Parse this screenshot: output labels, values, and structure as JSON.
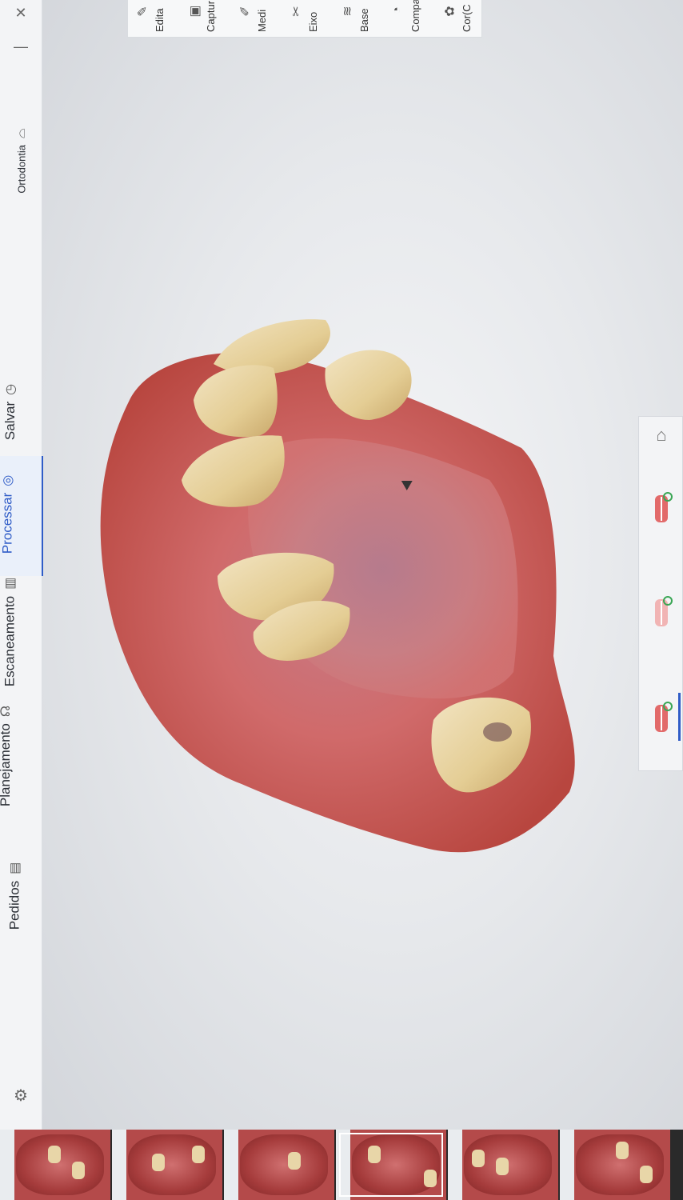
{
  "window": {
    "close_icon": "close-icon",
    "minimize_icon": "minimize-icon"
  },
  "module": {
    "label": "Ortodontia",
    "icon": "tooth-icon"
  },
  "nav": {
    "items": [
      {
        "label": "Salvar",
        "icon": "clock-icon"
      },
      {
        "label": "Processar",
        "icon": "process-icon",
        "active": true
      },
      {
        "label": "Escaneamento",
        "icon": "scanner-icon"
      },
      {
        "label": "Planejamento",
        "icon": "tooth-plan-icon"
      },
      {
        "label": "Pedidos",
        "icon": "orders-icon"
      }
    ],
    "settings_icon": "gear-icon"
  },
  "tools": [
    {
      "label": "Edita",
      "icon": "edit-icon"
    },
    {
      "label": "Captur",
      "icon": "capture-icon"
    },
    {
      "label": "Medi",
      "icon": "ruler-icon"
    },
    {
      "label": "Eixo",
      "icon": "axis-icon"
    },
    {
      "label": "Base",
      "icon": "layers-icon"
    },
    {
      "label": "Compa",
      "icon": "compare-icon"
    },
    {
      "label": "Cor(C",
      "icon": "color-icon"
    }
  ],
  "jaw_panel": {
    "items": [
      {
        "name": "home-view-icon"
      },
      {
        "name": "upper-jaw-icon"
      },
      {
        "name": "lower-jaw-icon"
      },
      {
        "name": "both-jaws-icon",
        "selected": true
      }
    ]
  },
  "colors": {
    "accent": "#2f5cc7",
    "gum": "#c65a5a",
    "tooth": "#e8d6a8"
  },
  "thumbnails": [
    {
      "label": ""
    },
    {
      "label": ""
    },
    {
      "label": ""
    },
    {
      "label": "",
      "selected": true
    },
    {
      "label": ""
    },
    {
      "label": ""
    }
  ]
}
